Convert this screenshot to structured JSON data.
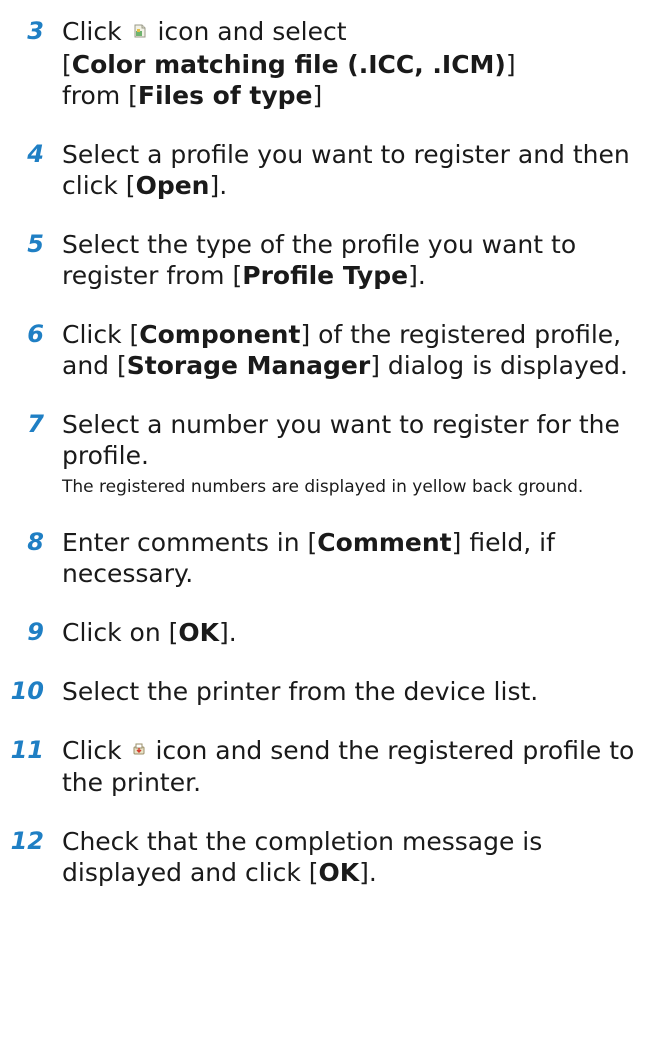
{
  "steps": [
    {
      "num": "3",
      "pre": "Click ",
      "icon": "open-file-icon",
      "mid": " icon and select",
      "line2_open": "[",
      "line2_bold": "Color matching file (.ICC, .ICM)",
      "line2_close": "]",
      "line3_pre": "from [",
      "line3_bold": "Files of type",
      "line3_close": "]"
    },
    {
      "num": "4",
      "pre": "Select a profile you want to register and then click [",
      "bold": "Open",
      "post": "]."
    },
    {
      "num": "5",
      "pre": "Select the type of the profile you want to register from [",
      "bold": "Profile Type",
      "post": "]."
    },
    {
      "num": "6",
      "pre": "Click [",
      "bold": "Component",
      "mid": "] of the registered profile, and [",
      "bold2": "Storage Manager",
      "post": "] dialog is displayed."
    },
    {
      "num": "7",
      "text": "Select a number you want to register for the profile.",
      "note": "The registered numbers are displayed in yellow back ground."
    },
    {
      "num": "8",
      "pre": "Enter comments in [",
      "bold": "Comment",
      "post": "] field, if necessary."
    },
    {
      "num": "9",
      "pre": "Click on [",
      "bold": "OK",
      "post": "]."
    },
    {
      "num": "10",
      "text": "Select the printer from the device list."
    },
    {
      "num": "11",
      "pre": "Click ",
      "icon": "send-to-printer-icon",
      "post": " icon and send the registered profile to the printer."
    },
    {
      "num": "12",
      "pre": "Check that the completion message is displayed and click [",
      "bold": "OK",
      "post": "]."
    }
  ],
  "colors": {
    "step_number": "#1f7fc4",
    "text": "#1a1a1a"
  }
}
